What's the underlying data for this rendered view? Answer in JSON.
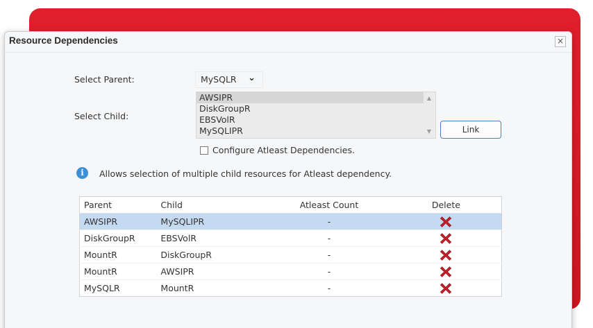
{
  "dialog": {
    "title": "Resource Dependencies",
    "close_symbol": "×"
  },
  "form": {
    "parent_label": "Select Parent:",
    "parent_value": "MySQLR",
    "child_label": "Select Child:",
    "child_options": [
      "AWSIPR",
      "DiskGroupR",
      "EBSVolR",
      "MySQLIPR"
    ],
    "child_selected": "AWSIPR",
    "link_label": "Link",
    "atleast_label": "Configure Atleast Dependencies.",
    "atleast_checked": false,
    "info_text": "Allows selection of multiple child resources for Atleast dependency."
  },
  "table": {
    "headers": {
      "parent": "Parent",
      "child": "Child",
      "atleast": "Atleast Count",
      "delete": "Delete"
    },
    "rows": [
      {
        "parent": "AWSIPR",
        "child": "MySQLIPR",
        "atleast": "-"
      },
      {
        "parent": "DiskGroupR",
        "child": "EBSVolR",
        "atleast": "-"
      },
      {
        "parent": "MountR",
        "child": "DiskGroupR",
        "atleast": "-"
      },
      {
        "parent": "MountR",
        "child": "AWSIPR",
        "atleast": "-"
      },
      {
        "parent": "MySQLR",
        "child": "MountR",
        "atleast": "-"
      }
    ],
    "selected_row": 0
  },
  "colors": {
    "backdrop_red": "#e11f2c",
    "selected_row": "#c5daf0",
    "delete_icon": "#c8202b",
    "info_icon": "#3d8fd6",
    "link_border": "#4a7fc1"
  },
  "icons": {
    "info": "info-icon",
    "delete": "delete-x-icon",
    "close": "close-icon",
    "dropdown": "chevron-down-icon"
  }
}
